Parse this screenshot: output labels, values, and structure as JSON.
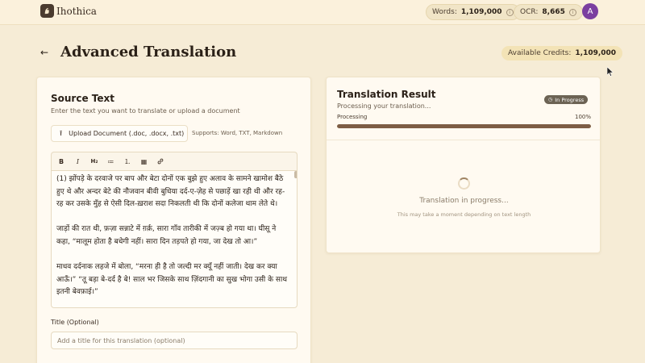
{
  "header": {
    "app_name": "Ihothica",
    "words_label": "Words:",
    "words_value": "1,109,000",
    "ocr_label": "OCR:",
    "ocr_value": "8,665",
    "avatar_initial": "A"
  },
  "page": {
    "back_icon": "arrow-left-icon",
    "title": "Advanced Translation",
    "credits_label": "Available Credits:",
    "credits_value": "1,109,000"
  },
  "source": {
    "title": "Source Text",
    "subtitle": "Enter the text you want to translate or upload a document",
    "upload_label": "Upload Document (.doc, .docx, .txt)",
    "supports": "Supports: Word, TXT, Markdown",
    "toolbar": [
      {
        "name": "bold-icon",
        "glyph": "B"
      },
      {
        "name": "italic-icon",
        "glyph": "I"
      },
      {
        "name": "heading-icon",
        "glyph": "H₂"
      },
      {
        "name": "bullet-list-icon",
        "glyph": "≔"
      },
      {
        "name": "numbered-list-icon",
        "glyph": "⒈"
      },
      {
        "name": "table-icon",
        "glyph": "▦"
      },
      {
        "name": "link-icon",
        "glyph": "🔗"
      }
    ],
    "editor_text": "(1) झोंपड़े के दरवाजे पर बाप और बेटा दोनों एक बुझे हुए अलाव के सामने खामोश बैठे हुए थे और अन्दर बेटे की नौजवान बीवी बुधिया दर्द-ए-ज़ेह से पछाड़ें खा रही थी और रह-रह कर उसके मुँह से ऐसी दिल-ख़राश सदा निकलती थी कि दोनों कलेजा थाम लेते थे।\n\nजाड़ों की रात थी, फ़ज़ा सन्नाटे में ग़र्क़, सारा गाँव तारीकी में जज़्ब हो गया था। घीसू ने कहा, “मालूम होता है बचेगी नहीं। सारा दिन तड़पते हो गया, जा देख तो आ।”\n\nमाधव दर्दनाक लहजे में बोला, “मरना ही है तो जल्दी मर क्यूँ नहीं जाती। देख कर क्या आऊँ।” “तू बड़ा बे-दर्द है बे! साल भर जिसके साथ ज़िंदगानी का सुख भोगा उसी के साथ इतनी बेवफ़ाई।”",
    "title_field_label": "Title (Optional)",
    "title_field_placeholder": "Add a title for this translation (optional)",
    "title_field_value": ""
  },
  "result": {
    "title": "Translation Result",
    "status": "In Progress",
    "subtitle": "Processing your translation...",
    "progress_label": "Processing",
    "progress_text": "100%",
    "progress_fraction": 1.0,
    "main_message": "Translation in progress...",
    "note": "This may take a moment depending on text length"
  },
  "colors": {
    "background": "#f6ecd6",
    "card": "#fffaf1",
    "accent": "#7d5d45",
    "avatar": "#7b3fa0",
    "status_badge": "#6c6354"
  }
}
